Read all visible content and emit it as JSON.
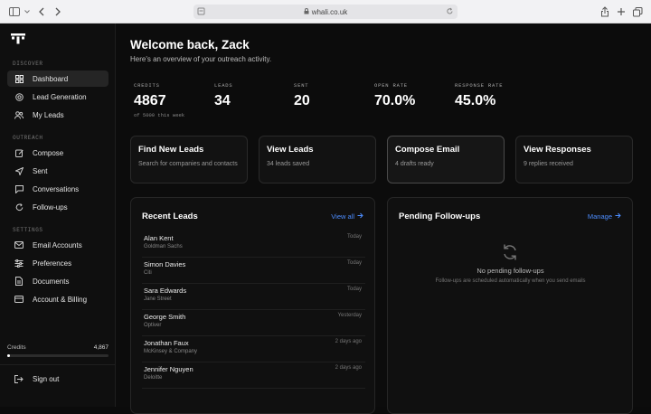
{
  "browser": {
    "url": "whali.co.uk"
  },
  "sidebar": {
    "sections": {
      "discover": "DISCOVER",
      "outreach": "OUTREACH",
      "settings": "SETTINGS"
    },
    "items": [
      {
        "label": "Dashboard",
        "icon": "grid-icon",
        "active": true
      },
      {
        "label": "Lead Generation",
        "icon": "target-icon"
      },
      {
        "label": "My Leads",
        "icon": "users-icon"
      },
      {
        "label": "Compose",
        "icon": "pencil-icon"
      },
      {
        "label": "Sent",
        "icon": "send-icon"
      },
      {
        "label": "Conversations",
        "icon": "chat-icon"
      },
      {
        "label": "Follow-ups",
        "icon": "refresh-icon"
      },
      {
        "label": "Email Accounts",
        "icon": "mail-icon"
      },
      {
        "label": "Preferences",
        "icon": "sliders-icon"
      },
      {
        "label": "Documents",
        "icon": "document-icon"
      },
      {
        "label": "Account & Billing",
        "icon": "card-icon"
      }
    ],
    "credits_label": "Credits",
    "credits_value": "4,867",
    "credits_fraction": 0.03,
    "signout": "Sign out"
  },
  "main": {
    "title": "Welcome back, Zack",
    "subtitle": "Here's an overview of your outreach activity.",
    "stats": [
      {
        "label": "CREDITS",
        "value": "4867",
        "sub": "of 5000 this week"
      },
      {
        "label": "LEADS",
        "value": "34"
      },
      {
        "label": "SENT",
        "value": "20"
      },
      {
        "label": "OPEN RATE",
        "value": "70.0%"
      },
      {
        "label": "RESPONSE RATE",
        "value": "45.0%"
      }
    ],
    "cards": [
      {
        "title": "Find New Leads",
        "sub": "Search for companies and contacts"
      },
      {
        "title": "View Leads",
        "sub": "34 leads saved"
      },
      {
        "title": "Compose Email",
        "sub": "4 drafts ready"
      },
      {
        "title": "View Responses",
        "sub": "9 replies received"
      }
    ],
    "recent": {
      "title": "Recent Leads",
      "link": "View all",
      "rows": [
        {
          "name": "Alan Kent",
          "company": "Goldman Sachs",
          "time": "Today"
        },
        {
          "name": "Simon Davies",
          "company": "Citi",
          "time": "Today"
        },
        {
          "name": "Sara Edwards",
          "company": "Jane Street",
          "time": "Today"
        },
        {
          "name": "George Smith",
          "company": "Optiver",
          "time": "Yesterday"
        },
        {
          "name": "Jonathan Faux",
          "company": "McKinsey & Company",
          "time": "2 days ago"
        },
        {
          "name": "Jennifer Nguyen",
          "company": "Deloitte",
          "time": "2 days ago"
        }
      ]
    },
    "followups": {
      "title": "Pending Follow-ups",
      "link": "Manage",
      "empty_title": "No pending follow-ups",
      "empty_sub": "Follow-ups are scheduled automatically when you send emails"
    }
  }
}
